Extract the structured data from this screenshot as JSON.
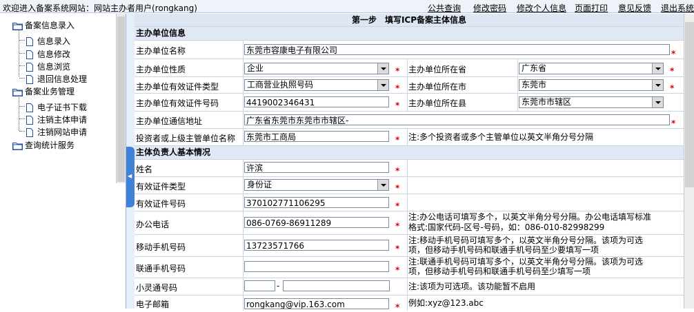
{
  "header": {
    "welcome": "欢迎进入备案系统网站：网站主办者用户(rongkang)",
    "links": [
      "公共查询",
      "修改密码",
      "修改个人信息",
      "页面打印",
      "意见反馈",
      "退出系统"
    ]
  },
  "tree": {
    "group1": "备案信息录入",
    "group1_items": [
      "信息录入",
      "信息修改",
      "信息浏览",
      "退回信息处理"
    ],
    "group2": "备案业务管理",
    "group2_items": [
      "电子证书下载",
      "注销主体申请",
      "注销网站申请"
    ],
    "group3": "查询统计服务"
  },
  "form": {
    "title": "第一步　填写ICP备案主体信息",
    "section1": "主办单位信息",
    "unit_name_label": "主办单位名称",
    "unit_name_value": "东莞市容康电子有限公司",
    "unit_nature_label": "主办单位性质",
    "unit_nature_value": "企业",
    "province_label": "主办单位所在省",
    "province_value": "广东省",
    "cert_type_label": "主办单位有效证件类型",
    "cert_type_value": "工商营业执照号码",
    "city_label": "主办单位所在市",
    "city_value": "东莞市",
    "cert_no_label": "主办单位有效证件号码",
    "cert_no_value": "4419002346431",
    "county_label": "主办单位所在县",
    "county_value": "东莞市市辖区",
    "address_label": "主办单位通信地址",
    "address_value": "广东省东莞市东莞市市辖区-",
    "investor_label": "投资者或上级主管单位名称",
    "investor_value": "东莞市工商局",
    "investor_note": "注:多个投资者或多个主管单位以英文半角分号分隔",
    "section2": "主体负责人基本情况",
    "name_label": "姓名",
    "name_value": "许滨",
    "id_type_label": "有效证件类型",
    "id_type_value": "身份证",
    "id_no_label": "有效证件号码",
    "id_no_value": "370102771106295",
    "office_phone_label": "办公电话",
    "office_phone_value": "086-0769-86911289",
    "office_phone_note1": "注:办公电话可填写多个，以英文半角分号分隔。办公电话填写标准",
    "office_phone_note2": "格式:国家代码-区号-号码，如：086-010-82998299",
    "mobile_label": "移动手机号码",
    "mobile_value": "13723571766",
    "mobile_note1": "注:移动手机号码可填写多个，以英文半角分号分隔。该项为可选",
    "mobile_note2": "项，但移动手机号码和联通手机号码至少要填写一项",
    "unicom_label": "联通手机号码",
    "unicom_value": "",
    "unicom_note1": "注:联通手机号码可填写多个，以英文半角分号分隔。该项为可选",
    "unicom_note2": "项，但移动手机号码和联通手机号码至少填写一项",
    "phs_label": "小灵通号码",
    "phs_dash": "-",
    "phs_note": "注:该项为可选项。该功能暂不启用",
    "email_label": "电子邮箱",
    "email_value": "rongkang@vip.163.com",
    "email_note": "例如:xyz@123.abc",
    "star": "*"
  }
}
